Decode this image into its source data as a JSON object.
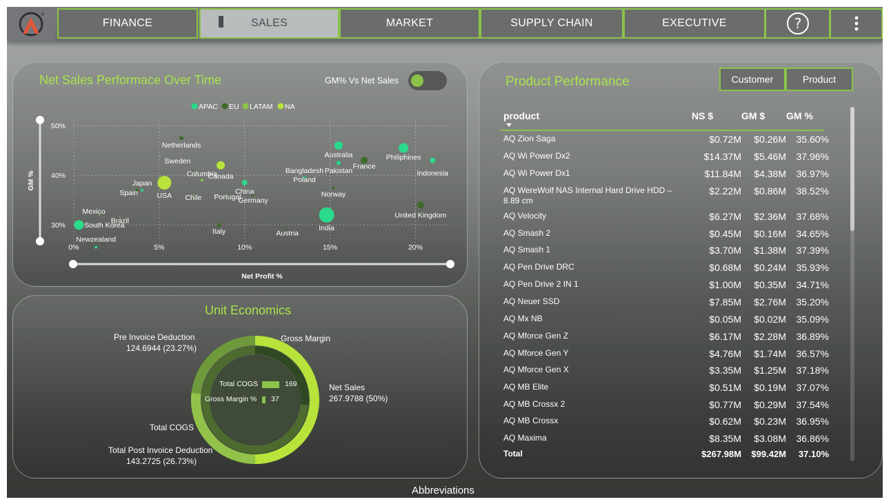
{
  "nav": {
    "tabs": [
      {
        "label": "FINANCE"
      },
      {
        "label": "SALES"
      },
      {
        "label": "MARKET"
      },
      {
        "label": "SUPPLY CHAIN"
      },
      {
        "label": "EXECUTIVE"
      }
    ],
    "active_tab": "SALES",
    "help_icon": "question-circle-icon",
    "more_icon": "vertical-ellipsis-icon",
    "logo_icon": "atliq-logo-icon"
  },
  "net_sales": {
    "title": "Net Sales Performace Over Time",
    "toggle_label": "GM% Vs Net Sales",
    "toggle_on": true,
    "legend": [
      {
        "name": "APAC",
        "color": "#2bd98a"
      },
      {
        "name": "EU",
        "color": "#3e6a2a"
      },
      {
        "name": "LATAM",
        "color": "#8bc34a"
      },
      {
        "name": "NA",
        "color": "#b7e33a"
      }
    ],
    "ylabel": "GM %",
    "xlabel": "Net Profit %"
  },
  "chart_data": {
    "type": "scatter",
    "xlabel": "Net Profit %",
    "ylabel": "GM %",
    "x_ticks": [
      "0%",
      "5%",
      "10%",
      "15%",
      "20%"
    ],
    "y_ticks": [
      "30%",
      "40%",
      "50%"
    ],
    "xlim": [
      0,
      22
    ],
    "ylim": [
      26,
      51
    ],
    "grid": true,
    "legend_position": "top",
    "series": [
      {
        "name": "APAC",
        "color": "#2bd98a",
        "points": [
          {
            "label": "Australia",
            "x": 15.5,
            "y": 46,
            "size": 6
          },
          {
            "label": "Philiphines",
            "x": 19.3,
            "y": 45.5,
            "size": 7
          },
          {
            "label": "Indonesia",
            "x": 21,
            "y": 43,
            "size": 4
          },
          {
            "label": "Pakistan",
            "x": 15.5,
            "y": 42.5,
            "size": 3
          },
          {
            "label": "Bangladesh",
            "x": 13.5,
            "y": 39.5,
            "size": 2
          },
          {
            "label": "China",
            "x": 10,
            "y": 38.5,
            "size": 4
          },
          {
            "label": "India",
            "x": 14.8,
            "y": 32,
            "size": 11
          },
          {
            "label": "South Korea",
            "x": 0.3,
            "y": 30,
            "size": 7
          },
          {
            "label": "Newzealand",
            "x": 1.3,
            "y": 25.5,
            "size": 2
          },
          {
            "label": "Japan",
            "x": 4,
            "y": 37,
            "size": 2
          }
        ]
      },
      {
        "name": "EU",
        "color": "#3e6a2a",
        "points": [
          {
            "label": "Netherlands",
            "x": 6.3,
            "y": 47.5,
            "size": 3
          },
          {
            "label": "France",
            "x": 17,
            "y": 43,
            "size": 5
          },
          {
            "label": "United Kingdom",
            "x": 20.3,
            "y": 34,
            "size": 5
          },
          {
            "label": "Norway",
            "x": 15.2,
            "y": 37.5,
            "size": 2
          },
          {
            "label": "Germany",
            "x": 10.5,
            "y": 36,
            "size": 2
          },
          {
            "label": "Italy",
            "x": 8.5,
            "y": 30,
            "size": 3
          },
          {
            "label": "Spain",
            "x": 3.7,
            "y": 37,
            "size": 2
          },
          {
            "label": "Sweden",
            "x": 7,
            "y": 41,
            "size": 1
          },
          {
            "label": "Poland",
            "x": 13.5,
            "y": 39.5,
            "size": 1
          },
          {
            "label": "Portugal",
            "x": 9,
            "y": 36,
            "size": 1
          },
          {
            "label": "Austria",
            "x": 12.5,
            "y": 29,
            "size": 1
          }
        ]
      },
      {
        "name": "LATAM",
        "color": "#8bc34a",
        "points": [
          {
            "label": "Columbia",
            "x": 7.5,
            "y": 39,
            "size": 2
          },
          {
            "label": "Chile",
            "x": 7,
            "y": 36,
            "size": 1
          },
          {
            "label": "Mexico",
            "x": 1.5,
            "y": 32,
            "size": 1
          },
          {
            "label": "Brazil",
            "x": 2.7,
            "y": 31.5,
            "size": 1
          }
        ]
      },
      {
        "name": "NA",
        "color": "#b7e33a",
        "points": [
          {
            "label": "USA",
            "x": 5.3,
            "y": 38.5,
            "size": 10
          },
          {
            "label": "Canada",
            "x": 8.6,
            "y": 42,
            "size": 6
          }
        ]
      }
    ]
  },
  "unit_economics": {
    "title": "Unit Economics",
    "labels": {
      "pre_invoice": "Pre Invoice Deduction",
      "pre_invoice_value": "124.6944 (23.27%)",
      "gross_margin": "Gross Margin",
      "net_sales": "Net Sales",
      "net_sales_value": "267.9788 (50%)",
      "total_cogs": "Total COGS",
      "post_invoice": "Total Post Invoice Deduction",
      "post_invoice_value": "143.2725 (26.73%)"
    },
    "inner_bars": [
      {
        "label": "Total COGS",
        "value": "169",
        "fraction": 1.0
      },
      {
        "label": "Gross Margin %",
        "value": "37",
        "fraction": 0.22
      }
    ],
    "colors": {
      "net_sales": "#b7e33a",
      "pre_invoice": "#6f9a3c",
      "post_invoice": "#93c24b",
      "cogs": "#4d6a2f",
      "gm": "#2f4a22"
    }
  },
  "product_performance": {
    "title": "Product Performance",
    "buttons": [
      "Customer",
      "Product"
    ],
    "columns": [
      "product",
      "NS $",
      "GM $",
      "GM %"
    ],
    "rows": [
      {
        "name": "AQ Zion Saga",
        "ns": "$0.72M",
        "gm": "$0.26M",
        "gmp": "35.60%"
      },
      {
        "name": "AQ Wi Power Dx2",
        "ns": "$14.37M",
        "gm": "$5.46M",
        "gmp": "37.96%"
      },
      {
        "name": "AQ Wi Power Dx1",
        "ns": "$11.84M",
        "gm": "$4.38M",
        "gmp": "36.97%"
      },
      {
        "name": "AQ WereWolf NAS Internal Hard Drive HDD – 8.89 cm",
        "ns": "$2.22M",
        "gm": "$0.86M",
        "gmp": "38.52%"
      },
      {
        "name": "AQ Velocity",
        "ns": "$6.27M",
        "gm": "$2.36M",
        "gmp": "37.68%"
      },
      {
        "name": "AQ Smash 2",
        "ns": "$0.45M",
        "gm": "$0.16M",
        "gmp": "34.65%"
      },
      {
        "name": "AQ Smash 1",
        "ns": "$3.70M",
        "gm": "$1.38M",
        "gmp": "37.39%"
      },
      {
        "name": "AQ Pen Drive DRC",
        "ns": "$0.68M",
        "gm": "$0.24M",
        "gmp": "35.93%"
      },
      {
        "name": "AQ Pen Drive 2 IN 1",
        "ns": "$1.00M",
        "gm": "$0.35M",
        "gmp": "34.71%"
      },
      {
        "name": "AQ Neuer SSD",
        "ns": "$7.85M",
        "gm": "$2.76M",
        "gmp": "35.20%"
      },
      {
        "name": "AQ Mx NB",
        "ns": "$0.05M",
        "gm": "$0.02M",
        "gmp": "35.09%"
      },
      {
        "name": "AQ Mforce Gen Z",
        "ns": "$6.17M",
        "gm": "$2.28M",
        "gmp": "36.89%"
      },
      {
        "name": "AQ Mforce Gen Y",
        "ns": "$4.76M",
        "gm": "$1.74M",
        "gmp": "36.57%"
      },
      {
        "name": "AQ Mforce Gen X",
        "ns": "$3.35M",
        "gm": "$1.25M",
        "gmp": "37.18%"
      },
      {
        "name": "AQ MB Elite",
        "ns": "$0.51M",
        "gm": "$0.19M",
        "gmp": "37.07%"
      },
      {
        "name": "AQ MB Crossx 2",
        "ns": "$0.77M",
        "gm": "$0.29M",
        "gmp": "37.54%"
      },
      {
        "name": "AQ MB Crossx",
        "ns": "$0.62M",
        "gm": "$0.23M",
        "gmp": "36.95%"
      },
      {
        "name": "AQ Maxima",
        "ns": "$8.35M",
        "gm": "$3.08M",
        "gmp": "36.86%"
      }
    ],
    "total": {
      "name": "Total",
      "ns": "$267.98M",
      "gm": "$99.42M",
      "gmp": "37.10%"
    }
  },
  "footer": {
    "label": "Abbreviations"
  }
}
